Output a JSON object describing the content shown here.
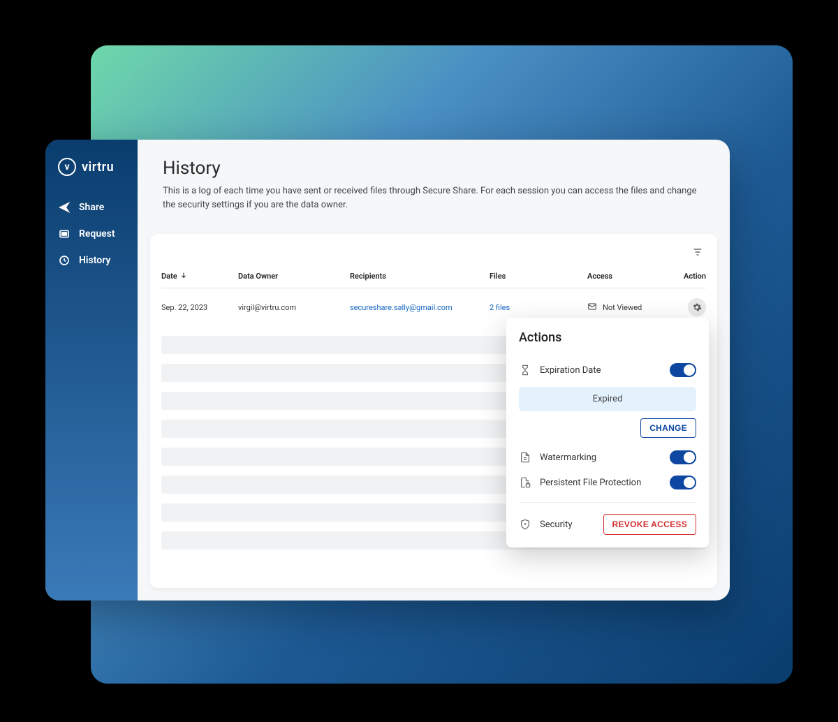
{
  "brand": {
    "name": "virtru"
  },
  "sidebar": {
    "items": [
      {
        "label": "Share"
      },
      {
        "label": "Request"
      },
      {
        "label": "History"
      }
    ]
  },
  "page": {
    "title": "History",
    "description": "This is a log of each time you have sent or received files through Secure Share. For each session you can access the files and change the security settings if you are the data owner."
  },
  "table": {
    "headers": {
      "date": "Date",
      "owner": "Data Owner",
      "recipients": "Recipients",
      "files": "Files",
      "access": "Access",
      "action": "Action"
    },
    "rows": [
      {
        "date": "Sep. 22, 2023",
        "owner": "virgil@virtru.com",
        "recipients": "secureshare.sally@gmail.com",
        "files": "2 files",
        "access": "Not Viewed"
      }
    ]
  },
  "popover": {
    "title": "Actions",
    "expiration_label": "Expiration Date",
    "expired_text": "Expired",
    "change_label": "CHANGE",
    "watermarking_label": "Watermarking",
    "pfp_label": "Persistent File Protection",
    "security_label": "Security",
    "revoke_label": "REVOKE ACCESS"
  }
}
